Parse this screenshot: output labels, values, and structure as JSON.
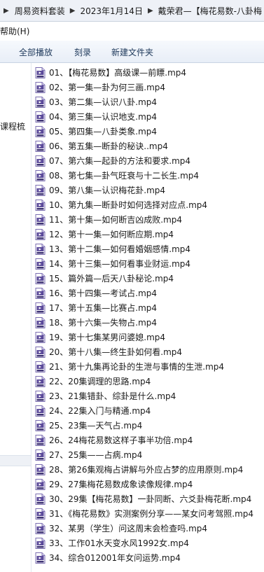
{
  "breadcrumb": {
    "items": [
      "周易资料套装",
      "2023年1月14日",
      "戴荣君—【梅花易数-八卦梅"
    ]
  },
  "menubar": {
    "help": "帮助(H)"
  },
  "toolbar": {
    "play_all": "全部播放",
    "burn": "刻录",
    "new_folder": "新建文件夹"
  },
  "navpane": {
    "label": "课程梳"
  },
  "files": [
    "01、【梅花易数】高级课—前瞟.mp4",
    "02、第一集—卦为何三画.mp4",
    "03、第二集—认识八卦.mp4",
    "04、第三集—认识地支.mp4",
    "05、第四集—八卦类象.mp4",
    "06、第五集—断卦的秘诀..mp4",
    "07、第六集—起卦的方法和要求.mp4",
    "08、第七集—卦气旺衰与十二长生.mp4",
    "09、第八集—认识梅花卦.mp4",
    "10、第九集—断卦时如何选择对应点.mp4",
    "11、第十集—如何断吉凶成败.mp4",
    "12、第十一集—如何断应期.mp4",
    "13、第十二集—如何看婚姻感情.mp4",
    "14、第十三集—如何看事业财运.mp4",
    "15、篇外篇—后天八卦秘论.mp4",
    "16、第十四集—考试占.mp4",
    "17、第十五集—比赛占.mp4",
    "18、第十六集—失物占.mp4",
    "19、第十七集某男问婆媳.mp4",
    "20、第十八集—终生卦如何看.mp4",
    "21、第十九集再论卦的生泄与事情的生泄.mp4",
    "22、20集调理的思路.mp4",
    "23、21集错卦、综卦是什么.mp4",
    "24、22集入门与精通.mp4",
    "25、23集—天气占.mp4",
    "26、24梅花易数这样子事半功倍.mp4",
    "27、25集——占病.mp4",
    "28、第26集观梅占讲解与外应占梦的应用原则.mp4",
    "29、27集梅花易数成象读像规律.mp4",
    "30、29集【梅花易数】一卦同断、六爻卦梅花断.mp4",
    "31、《梅花易数》实测案例分享——某女问考驾照.mp4",
    "32、某男（学生）问这周末会检查吗.mp4",
    "33、工作01水天变水风1992女.mp4",
    "34、综合012001年女问运势.mp4"
  ],
  "icons": {
    "file": "mp4-video-file-icon"
  },
  "colors": {
    "toolbar_text": "#1e395b",
    "icon_purple": "#5b4a9a"
  }
}
